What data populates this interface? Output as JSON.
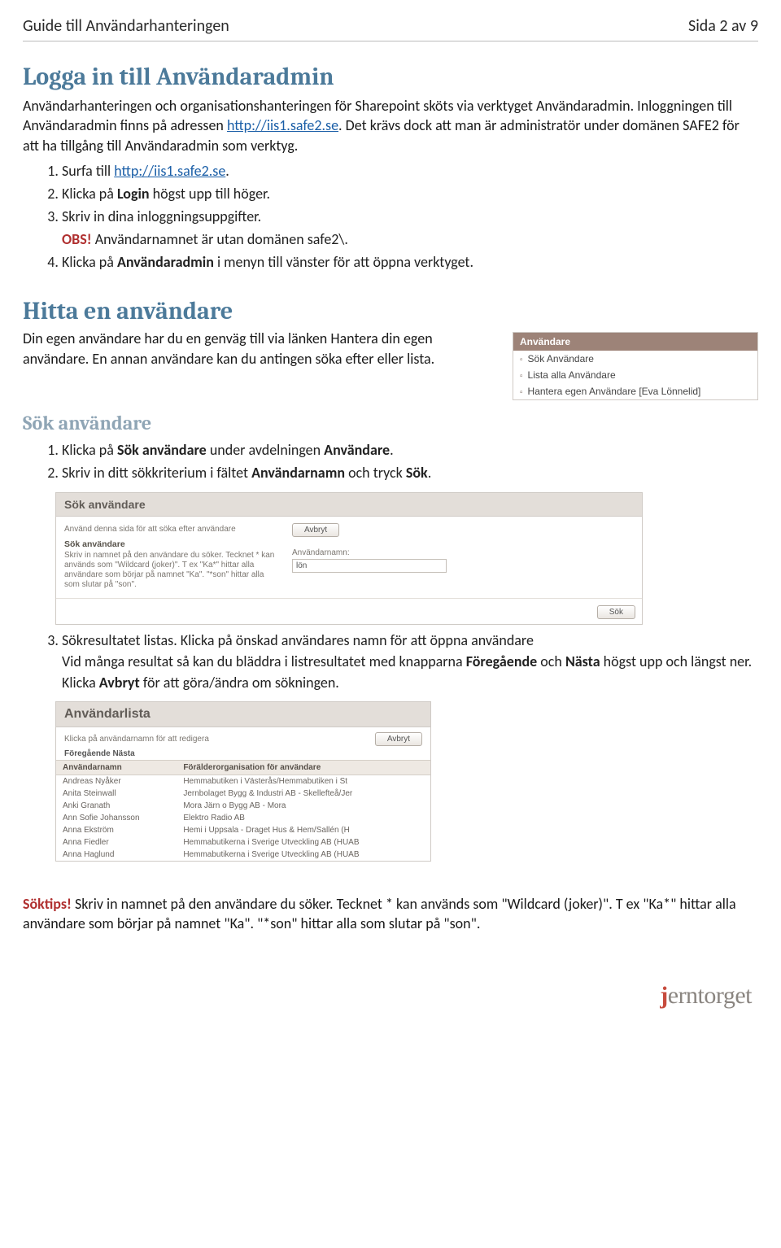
{
  "header": {
    "left": "Guide till Användarhanteringen",
    "right": "Sida 2 av 9"
  },
  "sec1": {
    "h": "Logga in till Användaradmin",
    "p1a": "Användarhanteringen och organisationshanteringen för Sharepoint sköts via verktyget Användaradmin. Inloggningen till Användaradmin finns på adressen ",
    "link1": "http://iis1.safe2.se",
    "p1b": ". Det krävs dock att man är administratör under domänen SAFE2 för att ha tillgång till Användaradmin som verktyg.",
    "ol": {
      "i1a": "Surfa till ",
      "i1link": "http://iis1.safe2.se",
      "i1b": ".",
      "i2a": "Klicka på ",
      "i2bold": "Login",
      "i2b": " högst upp till höger.",
      "i3": "Skriv in dina inloggningsuppgifter.",
      "obs_label": "OBS!",
      "obs_text": " Användarnamnet är utan domänen safe2\\.",
      "i4a": "Klicka på ",
      "i4bold": "Användaradmin",
      "i4b": " i menyn till vänster för att öppna verktyget."
    }
  },
  "sec2": {
    "h": "Hitta en användare",
    "p": "Din egen användare har du en genväg till via länken Hantera din egen användare. En annan användare kan du antingen söka efter eller lista.",
    "sidepanel": {
      "title": "Användare",
      "items": [
        "Sök Användare",
        "Lista alla Användare",
        "Hantera egen Användare [Eva Lönnelid]"
      ]
    }
  },
  "sec3": {
    "h": "Sök användare",
    "ol1": {
      "i1a": "Klicka på ",
      "i1bold": "Sök användare",
      "i1b": " under avdelningen ",
      "i1bold2": "Användare",
      "i1c": ".",
      "i2a": "Skriv in ditt sökkriterium i fältet ",
      "i2bold": "Användarnamn",
      "i2b": " och tryck ",
      "i2bold2": "Sök",
      "i2c": "."
    },
    "searchpanel": {
      "title": "Sök användare",
      "hint1": "Använd denna sida för att söka efter användare",
      "sub": "Sök användare",
      "hint2": "Skriv in namnet på den användare du söker. Tecknet * kan används som \"Wildcard (joker)\". T ex \"Ka*\" hittar alla användare som börjar på namnet \"Ka\". \"*son\" hittar alla som slutar på \"son\".",
      "avbryt": "Avbryt",
      "fieldlabel": "Användarnamn:",
      "fieldvalue": "lön",
      "sok": "Sök"
    },
    "ol2": {
      "i3a": "Sökresultatet listas. Klicka på önskad användares namn för att öppna användare\nVid många resultat så kan du bläddra i listresultatet med knapparna ",
      "i3bold1": "Föregående",
      "i3b": " och ",
      "i3bold2": "Nästa",
      "i3c": " högst upp och längst ner. Klicka ",
      "i3bold3": "Avbryt",
      "i3d": " för att göra/ändra om sökningen."
    },
    "userlist": {
      "title": "Användarlista",
      "hint": "Klicka på användarnamn för att redigera",
      "avbryt": "Avbryt",
      "nav": "Föregående Nästa",
      "col1": "Användarnamn",
      "col2": "Förälderorganisation för användare",
      "rows": [
        {
          "name": "Andreas Nyåker",
          "org": "Hemmabutiken i Västerås/Hemmabutiken i St"
        },
        {
          "name": "Anita Steinwall",
          "org": "Jernbolaget Bygg & Industri AB - Skellefteå/Jer"
        },
        {
          "name": "Anki Granath",
          "org": "Mora Järn o Bygg AB - Mora"
        },
        {
          "name": "Ann Sofie Johansson",
          "org": "Elektro Radio AB"
        },
        {
          "name": "Anna Ekström",
          "org": "Hemi i Uppsala - Draget Hus & Hem/Sallén (H"
        },
        {
          "name": "Anna Fiedler",
          "org": "Hemmabutikerna i Sverige Utveckling AB (HUAB"
        },
        {
          "name": "Anna Haglund",
          "org": "Hemmabutikerna i Sverige Utveckling AB (HUAB"
        }
      ]
    }
  },
  "soktips": {
    "label": "Söktips!",
    "text": " Skriv in namnet på den användare du söker. Tecknet * kan används som \"Wildcard (joker)\". T ex \"Ka*\" hittar alla användare som börjar på namnet \"Ka\". \"*son\" hittar alla som slutar på \"son\"."
  },
  "logo": {
    "j": "j",
    "rest": "erntorget"
  }
}
